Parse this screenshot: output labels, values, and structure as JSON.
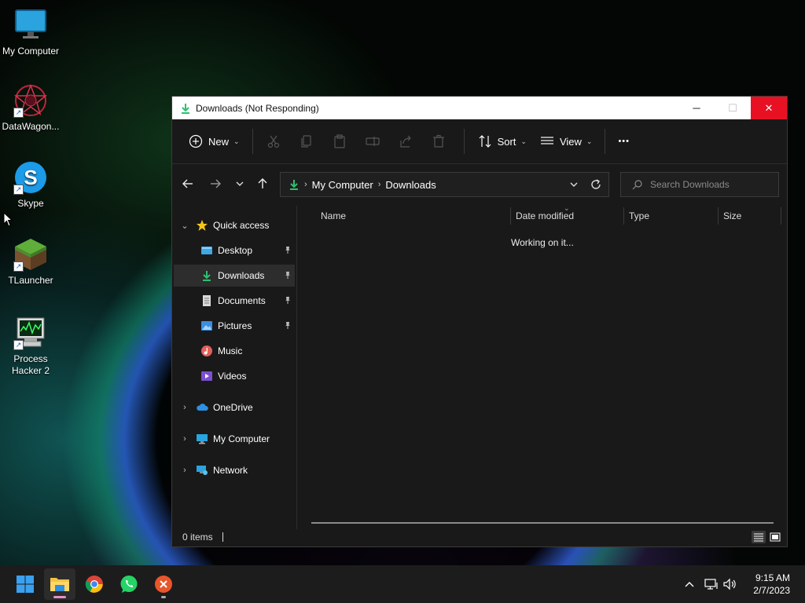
{
  "desktop": {
    "icons": [
      {
        "label": "My Computer"
      },
      {
        "label": "DataWagon..."
      },
      {
        "label": "Skype"
      },
      {
        "label": "TLauncher"
      },
      {
        "label": "Process Hacker 2"
      }
    ]
  },
  "window": {
    "title": "Downloads (Not Responding)",
    "controls": {
      "minimize": "─",
      "maximize": "☐",
      "close": "✕"
    }
  },
  "cmdbar": {
    "new_label": "New",
    "sort_label": "Sort",
    "view_label": "View",
    "more_label": "•••"
  },
  "address": {
    "path": [
      "My Computer",
      "Downloads"
    ],
    "search_placeholder": "Search Downloads"
  },
  "nav": {
    "quick_access": "Quick access",
    "items": [
      {
        "label": "Desktop",
        "pinned": true
      },
      {
        "label": "Downloads",
        "pinned": true,
        "selected": true
      },
      {
        "label": "Documents",
        "pinned": true
      },
      {
        "label": "Pictures",
        "pinned": true
      },
      {
        "label": "Music",
        "pinned": false
      },
      {
        "label": "Videos",
        "pinned": false
      }
    ],
    "onedrive": "OneDrive",
    "my_computer": "My Computer",
    "network": "Network"
  },
  "content": {
    "columns": [
      "Name",
      "Date modified",
      "Type",
      "Size"
    ],
    "status_message": "Working on it..."
  },
  "status": {
    "items_count": "0 items"
  },
  "taskbar": {
    "apps": [
      "start",
      "file-explorer",
      "chrome",
      "whatsapp",
      "app-x"
    ],
    "time": "9:15 AM",
    "date": "2/7/2023"
  },
  "colors": {
    "accent_green": "#2fbf71",
    "close_red": "#e81123",
    "window_bg": "#191919",
    "titlebar_bg": "#ffffff"
  }
}
